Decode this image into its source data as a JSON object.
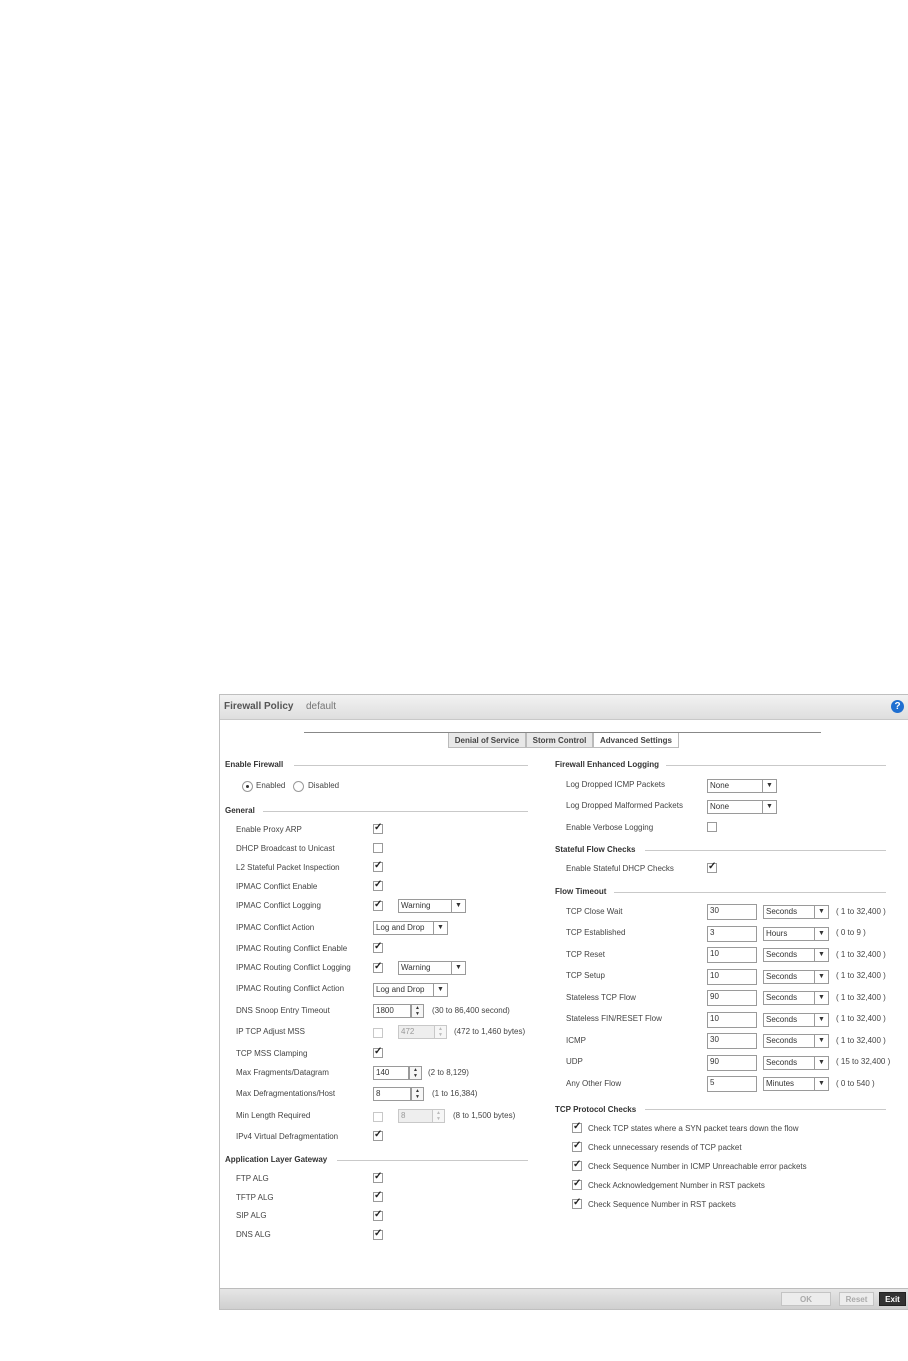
{
  "header": {
    "title": "Firewall Policy",
    "subtitle": "default",
    "help_icon": "?"
  },
  "tabs": [
    {
      "label": "Denial of Service"
    },
    {
      "label": "Storm Control"
    },
    {
      "label": "Advanced Settings",
      "active": true
    }
  ],
  "enable_firewall": {
    "section": "Enable Firewall",
    "enabled_label": "Enabled",
    "disabled_label": "Disabled",
    "selected": "Enabled"
  },
  "general": {
    "section": "General",
    "enable_proxy_arp": {
      "label": "Enable Proxy ARP",
      "checked": true
    },
    "dhcp_broadcast_unicast": {
      "label": "DHCP Broadcast to Unicast",
      "checked": false
    },
    "l2_stateful": {
      "label": "L2 Stateful Packet Inspection",
      "checked": true
    },
    "ipmac_conflict_enable": {
      "label": "IPMAC Conflict Enable",
      "checked": true
    },
    "ipmac_conflict_logging": {
      "label": "IPMAC Conflict Logging",
      "checked": true,
      "level": "Warning"
    },
    "ipmac_conflict_action": {
      "label": "IPMAC Conflict Action",
      "value": "Log and Drop"
    },
    "ipmac_routing_conflict_enable": {
      "label": "IPMAC Routing Conflict Enable",
      "checked": true
    },
    "ipmac_routing_conflict_logging": {
      "label": "IPMAC Routing Conflict Logging",
      "checked": true,
      "level": "Warning"
    },
    "ipmac_routing_conflict_action": {
      "label": "IPMAC Routing Conflict Action",
      "value": "Log and Drop"
    },
    "dns_snoop_timeout": {
      "label": "DNS Snoop Entry Timeout",
      "value": "1800",
      "hint": "(30 to 86,400 second)"
    },
    "ip_tcp_adjust_mss": {
      "label": "IP TCP Adjust MSS",
      "checked": false,
      "value": "472",
      "hint": "(472 to 1,460 bytes)"
    },
    "tcp_mss_clamping": {
      "label": "TCP MSS Clamping",
      "checked": true
    },
    "max_fragments": {
      "label": "Max Fragments/Datagram",
      "value": "140",
      "hint": "(2 to 8,129)"
    },
    "max_defrag": {
      "label": "Max Defragmentations/Host",
      "value": "8",
      "hint": "(1 to 16,384)"
    },
    "min_length": {
      "label": "Min Length Required",
      "checked": false,
      "value": "8",
      "hint": "(8 to 1,500 bytes)"
    },
    "ipv4_virtual_defrag": {
      "label": "IPv4 Virtual Defragmentation",
      "checked": true
    }
  },
  "alg": {
    "section": "Application Layer Gateway",
    "ftp": {
      "label": "FTP ALG",
      "checked": true
    },
    "tftp": {
      "label": "TFTP ALG",
      "checked": true
    },
    "sip": {
      "label": "SIP ALG",
      "checked": true
    },
    "dns": {
      "label": "DNS ALG",
      "checked": true
    }
  },
  "enhanced_logging": {
    "section": "Firewall Enhanced Logging",
    "icmp": {
      "label": "Log Dropped ICMP Packets",
      "value": "None"
    },
    "malformed": {
      "label": "Log Dropped Malformed Packets",
      "value": "None"
    },
    "verbose": {
      "label": "Enable Verbose Logging",
      "checked": false
    }
  },
  "stateful_flow": {
    "section": "Stateful Flow Checks",
    "dhcp": {
      "label": "Enable Stateful DHCP Checks",
      "checked": true
    }
  },
  "flow_timeout": {
    "section": "Flow Timeout",
    "rows": [
      {
        "label": "TCP Close Wait",
        "value": "30",
        "unit": "Seconds",
        "range": "( 1 to 32,400 )"
      },
      {
        "label": "TCP Established",
        "value": "3",
        "unit": "Hours",
        "range": "( 0 to 9 )"
      },
      {
        "label": "TCP Reset",
        "value": "10",
        "unit": "Seconds",
        "range": "( 1 to 32,400 )"
      },
      {
        "label": "TCP Setup",
        "value": "10",
        "unit": "Seconds",
        "range": "( 1 to 32,400 )"
      },
      {
        "label": "Stateless TCP Flow",
        "value": "90",
        "unit": "Seconds",
        "range": "( 1 to 32,400 )"
      },
      {
        "label": "Stateless FIN/RESET Flow",
        "value": "10",
        "unit": "Seconds",
        "range": "( 1 to 32,400 )"
      },
      {
        "label": "ICMP",
        "value": "30",
        "unit": "Seconds",
        "range": "( 1 to 32,400 )"
      },
      {
        "label": "UDP",
        "value": "90",
        "unit": "Seconds",
        "range": "( 15 to 32,400 )"
      },
      {
        "label": "Any Other Flow",
        "value": "5",
        "unit": "Minutes",
        "range": "( 0 to 540 )"
      }
    ]
  },
  "tcp_protocol_checks": {
    "section": "TCP Protocol Checks",
    "items": [
      {
        "label": "Check TCP states where a SYN packet tears down the flow",
        "checked": true
      },
      {
        "label": "Check unnecessary resends of TCP packet",
        "checked": true
      },
      {
        "label": "Check Sequence Number in ICMP Unreachable error packets",
        "checked": true
      },
      {
        "label": "Check Acknowledgement Number in RST packets",
        "checked": true
      },
      {
        "label": "Check Sequence Number in RST packets",
        "checked": true
      }
    ]
  },
  "footer": {
    "ok": "OK",
    "reset": "Reset",
    "exit": "Exit"
  }
}
